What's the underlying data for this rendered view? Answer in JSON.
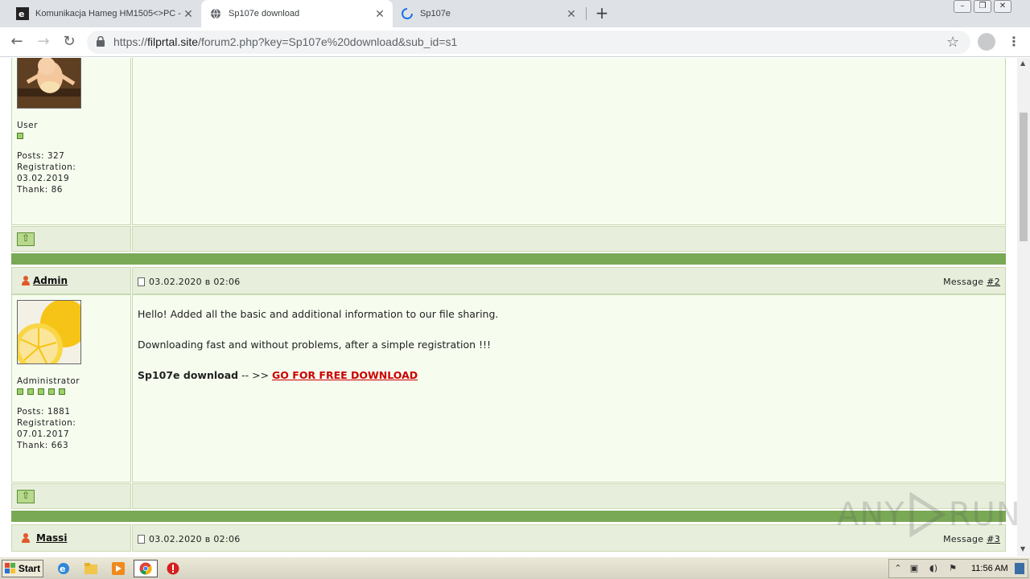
{
  "browser": {
    "tabs": [
      {
        "title": "Komunikacja Hameg HM1505<>PC -",
        "active": false
      },
      {
        "title": "Sp107e download",
        "active": true
      },
      {
        "title": "Sp107e",
        "active": false,
        "loading": true
      }
    ],
    "url_prefix": "https://",
    "url_domain": "filprtal.site",
    "url_path": "/forum2.php?key=Sp107e%20download&sub_id=s1"
  },
  "forum": {
    "post1": {
      "role": "User",
      "stars": 1,
      "posts": "Posts: 327",
      "reg_label": "Registration:",
      "reg_date": "03.02.2019",
      "thank": "Thank: 86"
    },
    "post2": {
      "author": "Admin",
      "date": "03.02.2020 в 02:06",
      "msg_label": "Message",
      "msg_num": "#2",
      "role": "Administrator",
      "stars": 5,
      "posts": "Posts: 1881",
      "reg_label": "Registration:",
      "reg_date": "07.01.2017",
      "thank": "Thank: 663",
      "line1": "Hello! Added all the basic and additional information to our file sharing.",
      "line2": "Downloading fast and without problems, after a simple registration !!!",
      "dl_title": "Sp107e download",
      "dl_arrow": "-- >>",
      "dl_link": "GO FOR FREE DOWNLOAD"
    },
    "post3": {
      "author": "Massi",
      "date": "03.02.2020 в 02:06",
      "msg_label": "Message",
      "msg_num": "#3"
    }
  },
  "watermark": {
    "left": "ANY",
    "right": "RUN"
  },
  "taskbar": {
    "start_label": "Start",
    "clock": "11:56 AM"
  },
  "colors": {
    "forum_bar": "#7aa956",
    "header_bg": "#e7eedb",
    "post_bg": "#f6fdef",
    "link_red": "#cc0000"
  }
}
